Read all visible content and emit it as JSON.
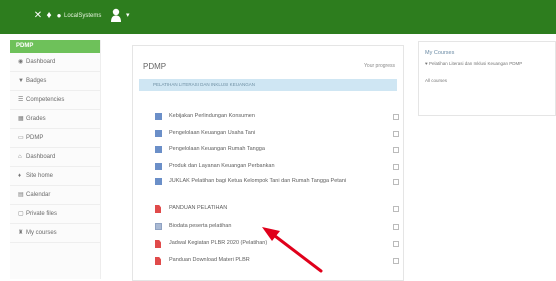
{
  "topbar": {
    "user_label": "LocalSystems",
    "icons": [
      "close-icon",
      "home-icon",
      "bell-icon",
      "user-icon",
      "chevron-down-icon"
    ]
  },
  "sidebar": {
    "header": "PDMP",
    "items": [
      {
        "icon": "dashboard-icon",
        "glyph": "◉",
        "label": "Dashboard"
      },
      {
        "icon": "badge-icon",
        "glyph": "▼",
        "label": "Badges"
      },
      {
        "icon": "competencies-icon",
        "glyph": "☰",
        "label": "Competencies"
      },
      {
        "icon": "grades-icon",
        "glyph": "▦",
        "label": "Grades"
      },
      {
        "icon": "course-icon",
        "glyph": "▭",
        "label": "PDMP"
      },
      {
        "icon": "dashboard-icon",
        "glyph": "⌂",
        "label": "Dashboard"
      },
      {
        "icon": "site-home-icon",
        "glyph": "♦",
        "label": "Site home"
      },
      {
        "icon": "calendar-icon",
        "glyph": "▤",
        "label": "Calendar"
      },
      {
        "icon": "private-files-icon",
        "glyph": "▢",
        "label": "Private files"
      },
      {
        "icon": "my-courses-icon",
        "glyph": "♜",
        "label": "My courses"
      }
    ]
  },
  "main": {
    "title": "PDMP",
    "link": "Your progress",
    "notice": "PELATIHAN LITERASI DAN INKLUSI KEUANGAN",
    "activities": [
      {
        "type": "page",
        "icon": "page-icon",
        "text": "Kebijakan Perlindungan Konsumen"
      },
      {
        "type": "page",
        "icon": "page-icon",
        "text": "Pengelolaan Keuangan Usaha Tani"
      },
      {
        "type": "page",
        "icon": "page-icon",
        "text": "Pengelolaan Keuangan Rumah Tangga"
      },
      {
        "type": "page",
        "icon": "page-icon",
        "text": "Produk dan Layanan Keuangan Perbankan"
      },
      {
        "type": "page",
        "icon": "page-icon",
        "text": "JUKLAK Pelatihan bagi Ketua Kelompok Tani dan Rumah Tangga Petani"
      },
      {
        "type": "pdf",
        "icon": "pdf-icon",
        "text": "PANDUAN PELATIHAN"
      },
      {
        "type": "quiz",
        "icon": "quiz-icon",
        "text": "Biodata peserta pelatihan"
      },
      {
        "type": "pdf",
        "icon": "pdf-icon",
        "text": "Jadwal Kegiatan PLBR 2020 (Pelatihan)"
      },
      {
        "type": "pdf",
        "icon": "pdf-icon",
        "text": "Panduan Download Materi PLBR"
      }
    ]
  },
  "courses_block": {
    "title": "My Courses",
    "item": "Pelatihan Literasi dan Inklusi Keuangan PDMP",
    "all_link": "All courses"
  },
  "colors": {
    "topbar": "#2d7d1e",
    "sidebar_header": "#6ec15a",
    "notice": "#cfe6f3",
    "arrow": "#e0001b"
  }
}
